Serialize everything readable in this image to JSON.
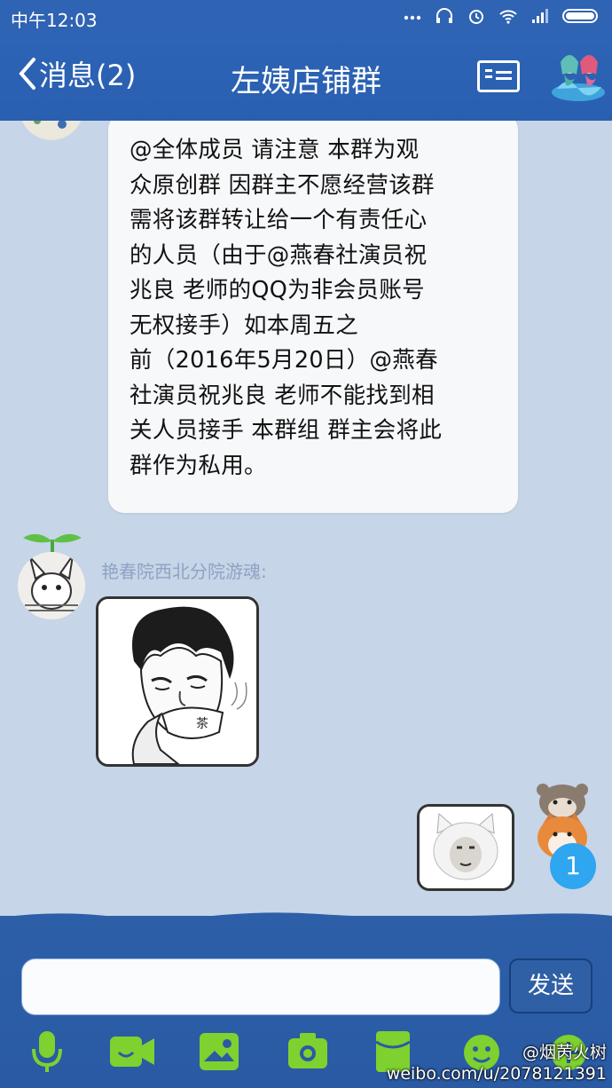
{
  "status_bar": {
    "time": "中午12:03"
  },
  "header": {
    "back_label": "消息(2)",
    "title": "左姨店铺群"
  },
  "messages": [
    {
      "type": "text",
      "lines": [
        "@全体成员 请注意 本群为观",
        "众原创群 因群主不愿经营该群",
        "需将该群转让给一个有责任心",
        "的人员（由于@燕春社演员祝",
        "兆良 老师的QQ为非会员账号",
        "无权接手）如本周五之",
        "前（2016年5月20日）@燕春",
        "社演员祝兆良 老师不能找到相",
        "关人员接手 本群组 群主会将此",
        "群作为私用。"
      ]
    },
    {
      "type": "image",
      "sender": "艳春院西北分院游魂:"
    },
    {
      "type": "image",
      "sender": "self"
    }
  ],
  "unread_badge": "1",
  "input": {
    "placeholder": "",
    "send_label": "发送"
  },
  "watermark": {
    "user": "@烟苪火树",
    "url": "weibo.com/u/2078121391"
  },
  "colors": {
    "header": "#2d64b6",
    "chat_bg": "#c6d5e7",
    "bubble": "#f7f8fa",
    "badge": "#2ea6f0",
    "toolbar_icon": "#7ed12f"
  }
}
